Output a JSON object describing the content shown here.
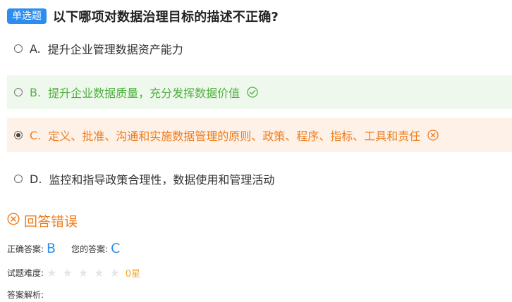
{
  "question": {
    "type_tag": "单选题",
    "title": "以下哪项对数据治理目标的描述不正确?"
  },
  "options": [
    {
      "letter": "A.",
      "text": "提升企业管理数据资产能力",
      "state": "normal",
      "selected": false
    },
    {
      "letter": "B.",
      "text": "提升企业数据质量，充分发挥数据价值",
      "state": "correct",
      "selected": false
    },
    {
      "letter": "C.",
      "text": "定义、批准、沟通和实施数据管理的原则、政策、程序、指标、工具和责任",
      "state": "wrong",
      "selected": true
    },
    {
      "letter": "D.",
      "text": "监控和指导政策合理性，数据使用和管理活动",
      "state": "normal",
      "selected": false
    }
  ],
  "result": {
    "text": "回答错误",
    "icon": "circle-x-icon"
  },
  "answers": {
    "correct_label": "正确答案:",
    "correct_value": "B",
    "yours_label": "您的答案:",
    "yours_value": "C"
  },
  "difficulty": {
    "label": "试题难度:",
    "stars_total": 5,
    "stars_filled": 0,
    "value_text": "0星"
  },
  "analysis": {
    "label": "答案解析:"
  },
  "colors": {
    "accent_blue": "#2d8cf0",
    "correct_green": "#52b043",
    "wrong_orange": "#f07d1c",
    "star_gold": "#f5a623"
  }
}
